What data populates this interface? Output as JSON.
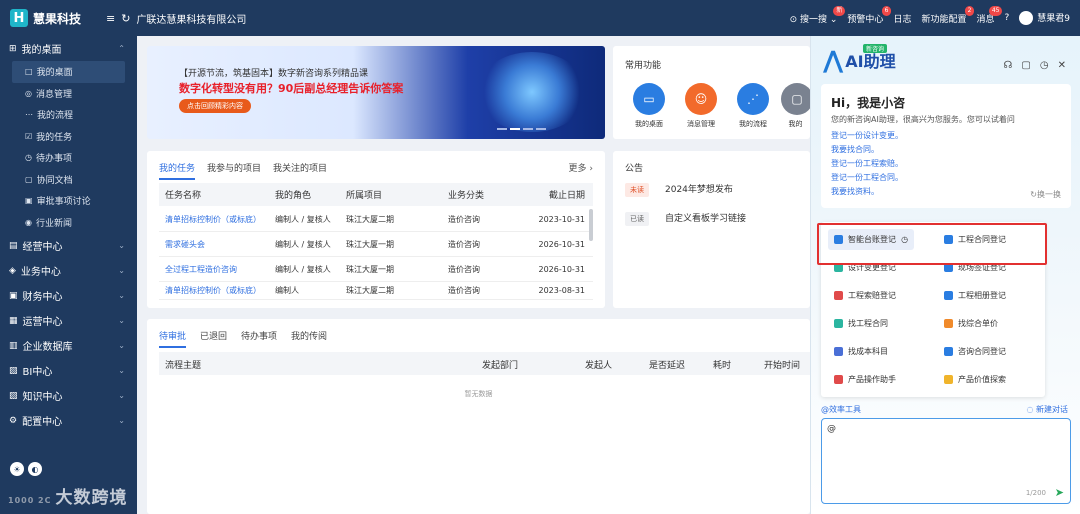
{
  "topbar": {
    "logo_letter": "H",
    "app_name": "慧果科技",
    "company": "广联达慧果科技有限公司",
    "items": [
      {
        "label": "搜一搜",
        "badge": "新"
      },
      {
        "label": "预警中心",
        "badge": "6"
      },
      {
        "label": "日志",
        "badge": ""
      },
      {
        "label": "新功能配置",
        "badge": "2"
      },
      {
        "label": "消息",
        "badge": "45"
      }
    ],
    "user": "慧果君9"
  },
  "sidebar": {
    "groups": [
      {
        "label": "我的桌面",
        "icon": "⊞"
      },
      {
        "label": "经营中心",
        "icon": "▤"
      },
      {
        "label": "业务中心",
        "icon": "◈"
      },
      {
        "label": "财务中心",
        "icon": "▣"
      },
      {
        "label": "运营中心",
        "icon": "▦"
      },
      {
        "label": "企业数据库",
        "icon": "▥"
      },
      {
        "label": "BI中心",
        "icon": "▧"
      },
      {
        "label": "知识中心",
        "icon": "▨"
      },
      {
        "label": "配置中心",
        "icon": "⚙"
      }
    ],
    "items": [
      {
        "label": "我的桌面",
        "icon": "□"
      },
      {
        "label": "消息管理",
        "icon": "◎"
      },
      {
        "label": "我的流程",
        "icon": "⋯"
      },
      {
        "label": "我的任务",
        "icon": "☑"
      },
      {
        "label": "待办事项",
        "icon": "◷"
      },
      {
        "label": "协同文档",
        "icon": "▢"
      },
      {
        "label": "审批事项讨论",
        "icon": "▣"
      },
      {
        "label": "行业新闻",
        "icon": "◉"
      }
    ],
    "watermark": "大数跨境",
    "watermark_prefix": "1000 2C"
  },
  "banner": {
    "line1": "【开源节流，筑基固本】数字新咨询系列精品课",
    "line2": "数字化转型没有用？90后副总经理告诉你答案",
    "button": "点击回顾精彩内容"
  },
  "tasks": {
    "tabs": [
      "我的任务",
      "我参与的项目",
      "我关注的项目"
    ],
    "more": "更多 ›",
    "headers": [
      "任务名称",
      "我的角色",
      "所属项目",
      "业务分类",
      "截止日期"
    ],
    "rows": [
      [
        "清单招标控制价（或标底）",
        "编制人 / 复核人",
        "珠江大厦二期",
        "造价咨询",
        "2023-10-31"
      ],
      [
        "需求碰头会",
        "编制人 / 复核人",
        "珠江大厦一期",
        "造价咨询",
        "2026-10-31"
      ],
      [
        "全过程工程造价咨询",
        "编制人 / 复核人",
        "珠江大厦一期",
        "造价咨询",
        "2026-10-31"
      ],
      [
        "清单招标控制价（或标底）",
        "编制人",
        "珠江大厦二期",
        "造价咨询",
        "2023-08-31"
      ]
    ]
  },
  "common": {
    "title": "常用功能",
    "apps": [
      {
        "label": "我的桌面",
        "color": "#2a7de1",
        "icon": "▭"
      },
      {
        "label": "消息管理",
        "color": "#f26a2b",
        "icon": "☺"
      },
      {
        "label": "我的流程",
        "color": "#2a7de1",
        "icon": "⋰"
      },
      {
        "label": "我的",
        "color": "#7a8290",
        "icon": "▢"
      }
    ]
  },
  "notice": {
    "title": "公告",
    "items": [
      {
        "tag": "未读",
        "text": "2024年梦想发布"
      },
      {
        "tag": "已读",
        "text": "自定义看板学习链接"
      }
    ]
  },
  "approve": {
    "tabs": [
      "待审批",
      "已退回",
      "待办事项",
      "我的传阅"
    ],
    "headers": [
      "流程主题",
      "发起部门",
      "发起人",
      "是否延迟",
      "耗时",
      "开始时间"
    ],
    "empty": "暂无数据"
  },
  "ai": {
    "tag": "新咨询",
    "name": "AI助理",
    "greet_title": "Hi，我是小咨",
    "greet_text": "您的新咨询AI助理，很高兴为您服务。您可以试着问",
    "suggestions": [
      "登记一份设计变更。",
      "我要找合同。",
      "登记一份工程索赔。",
      "登记一份工程合同。",
      "我要找资料。"
    ],
    "swap": "换一换",
    "menu": [
      {
        "label": "智能台账登记",
        "color": "#2a7de1"
      },
      {
        "label": "工程合同登记",
        "color": "#2a7de1"
      },
      {
        "label": "设计变更登记",
        "color": "#2bb5a0"
      },
      {
        "label": "现场签证登记",
        "color": "#2a7de1"
      },
      {
        "label": "工程索赔登记",
        "color": "#e04a4a"
      },
      {
        "label": "工程相册登记",
        "color": "#2a7de1"
      },
      {
        "label": "找工程合同",
        "color": "#2bb5a0"
      },
      {
        "label": "找综合单价",
        "color": "#f08a2b"
      },
      {
        "label": "找成本科目",
        "color": "#4a6fd6"
      },
      {
        "label": "咨询合同登记",
        "color": "#2a7de1"
      },
      {
        "label": "产品操作助手",
        "color": "#e04a4a"
      },
      {
        "label": "产品价值探索",
        "color": "#f0b42b"
      }
    ],
    "efficiency": "@效率工具",
    "new_chat": "新建对话",
    "input_value": "@",
    "counter": "1/200"
  }
}
